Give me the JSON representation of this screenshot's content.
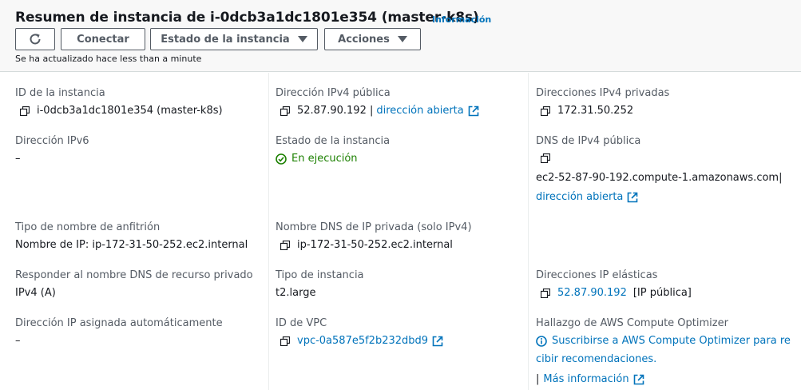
{
  "header": {
    "title": "Resumen de instancia de i-0dcb3a1dc1801e354 (master-k8s)",
    "info_link": "Información",
    "buttons": {
      "connect": "Conectar",
      "instance_state": "Estado de la instancia",
      "actions": "Acciones"
    },
    "updated_text": "Se ha actualizado hace less than a minute"
  },
  "details": {
    "instance_id": {
      "label": "ID de la instancia",
      "value": "i-0dcb3a1dc1801e354 (master-k8s)"
    },
    "public_ipv4": {
      "label": "Dirección IPv4 pública",
      "value": "52.87.90.192 |",
      "link": "dirección abierta"
    },
    "private_ipv4": {
      "label": "Direcciones IPv4 privadas",
      "value": "172.31.50.252"
    },
    "ipv6": {
      "label": "Dirección IPv6",
      "value": "–"
    },
    "instance_state": {
      "label": "Estado de la instancia",
      "value": "En ejecución"
    },
    "public_dns": {
      "label": "DNS de IPv4 pública",
      "value": "ec2-52-87-90-192.compute-1.amazonaws.com|",
      "link": "dirección abierta"
    },
    "hostname_type": {
      "label": "Tipo de nombre de anfitrión",
      "value": "Nombre de IP: ip-172-31-50-252.ec2.internal"
    },
    "private_dns": {
      "label": "Nombre DNS de IP privada (solo IPv4)",
      "value": "ip-172-31-50-252.ec2.internal"
    },
    "resource_dns": {
      "label": "Responder al nombre DNS de recurso privado",
      "value": "IPv4 (A)"
    },
    "instance_type": {
      "label": "Tipo de instancia",
      "value": "t2.large"
    },
    "elastic_ip": {
      "label": "Direcciones IP elásticas",
      "value": "52.87.90.192",
      "suffix": "[IP pública]"
    },
    "auto_ip": {
      "label": "Dirección IP asignada automáticamente",
      "value": "–"
    },
    "vpc_id": {
      "label": "ID de VPC",
      "value": "vpc-0a587e5f2b232dbd9"
    },
    "optimizer": {
      "label": "Hallazgo de AWS Compute Optimizer",
      "line1": "Suscribirse a AWS Compute Optimizer para re",
      "line2": "cibir recomendaciones.",
      "more_prefix": "|",
      "more": "Más información"
    }
  },
  "colors": {
    "link": "#0073bb",
    "running": "#1d8102",
    "border": "#545b64"
  },
  "icons": [
    "refresh-icon",
    "caret-down-icon",
    "copy-icon",
    "external-link-icon",
    "check-circle-icon",
    "info-circle-icon"
  ]
}
